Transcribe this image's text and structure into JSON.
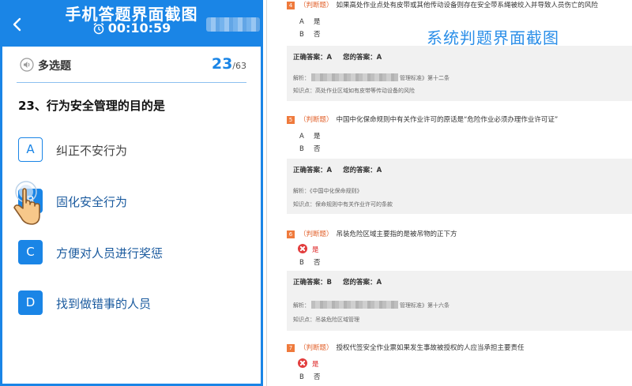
{
  "phone": {
    "title": "手机答题界面截图",
    "timer": "00:10:59",
    "question_type": "多选题",
    "progress": {
      "current": "23",
      "total": "/63"
    },
    "question": "23、行为安全管理的目的是",
    "options": [
      {
        "letter": "A",
        "text": "纠正不安行为",
        "state": "outline"
      },
      {
        "letter": "B",
        "text": "固化安全行为",
        "state": "filled"
      },
      {
        "letter": "C",
        "text": "方便对人员进行奖惩",
        "state": "filled"
      },
      {
        "letter": "D",
        "text": "找到做错事的人员",
        "state": "filled"
      }
    ],
    "accent_color": "#1a85e6"
  },
  "system": {
    "title": "系统判题界面截图",
    "questions": [
      {
        "num": "4",
        "tag": "（判断题）",
        "text": "如果高处作业点处有皮带或其他传动设备则存在安全带系绳被绞入并导致人员伤亡的风险",
        "choice_a": "是",
        "choice_b": "否",
        "answer_line": "正确答案：A",
        "your_answer": "您的答案：A",
        "analysis_prefix": "解析：",
        "analysis_suffix": "管理标准》第十二条",
        "knowledge": "知识点：高处作业区域如有皮带等传动设备的风险"
      },
      {
        "num": "5",
        "tag": "（判断题）",
        "text": "中国中化保命规则中有关作业许可的原话是“危险作业必须办理作业许可证”",
        "choice_a": "是",
        "choice_b": "否",
        "answer_line": "正确答案：A",
        "your_answer": "您的答案：A",
        "analysis_prefix": "解析：《中国中化保命规则》",
        "knowledge": "知识点：保命规则中有关作业许可的条款"
      },
      {
        "num": "6",
        "tag": "（判断题）",
        "text": "吊装危险区域主要指的是被吊物的正下方",
        "choice_a": "是",
        "choice_b": "否",
        "answer_line": "正确答案：B",
        "your_answer": "您的答案：A",
        "analysis_prefix": "解析：",
        "analysis_suffix": "管理标准》第十六条",
        "knowledge": "知识点：吊装危险区域管理"
      },
      {
        "num": "7",
        "tag": "（判断题）",
        "text": "授权代签安全作业票如果发生事故被授权的人应当承担主要责任",
        "choice_a": "是",
        "choice_b": "否"
      }
    ],
    "accent_color": "#ef7a3c",
    "wrong_color": "#e23d3d"
  }
}
